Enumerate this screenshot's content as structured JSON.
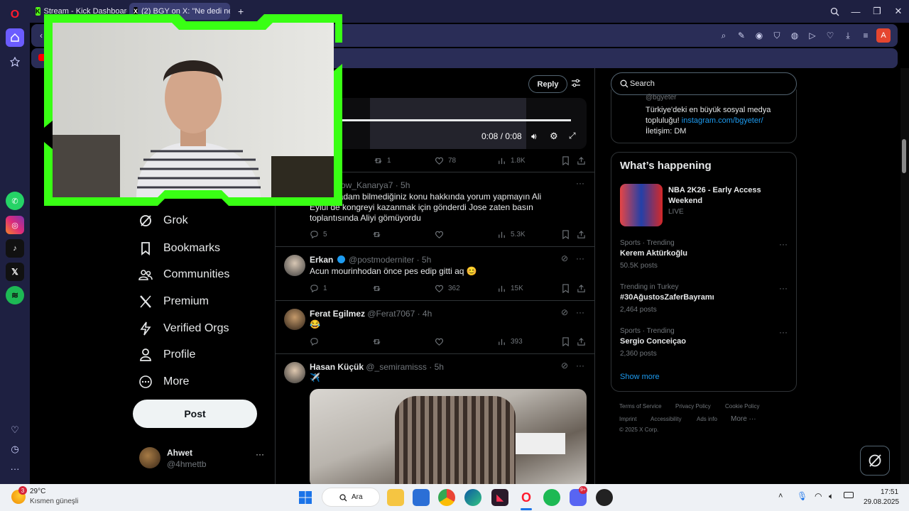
{
  "browser": {
    "tabs": [
      {
        "title": "Stream - Kick Dashboard",
        "icon": "kick-icon"
      },
      {
        "title": "(2) BGY on X: \"Ne dedi ne",
        "icon": "x-icon"
      }
    ],
    "add_tab": "+"
  },
  "x": {
    "nav": {
      "grok": "Grok",
      "bookmarks": "Bookmarks",
      "communities": "Communities",
      "premium": "Premium",
      "verified_orgs": "Verified Orgs",
      "profile": "Profile",
      "more": "More",
      "post": "Post"
    },
    "account": {
      "name": "Ahwet",
      "handle": "@4hmettb"
    },
    "thread_header": {
      "reply": "Reply"
    },
    "video": {
      "time": "0:08 / 0:08"
    },
    "top_tweet_stats": {
      "retweets": "1",
      "likes": "78",
      "views": "1.8K"
    },
    "tweets": [
      {
        "handle": "ow_Kanarya7 · 5h",
        "text": "değil ki adam bilmediğiniz konu hakkında yorum yapmayın Ali Eylül de kongreyi kazanmak için gönderdi Jose zaten basın toplantısında Aliyi gömüyordu",
        "replies": "5",
        "retweets": "",
        "likes": "",
        "views": "5.3K"
      },
      {
        "name": "Erkan",
        "handle": "@postmoderniter · 5h",
        "text": "Acun mourinhodan önce pes edip gitti aq 😊",
        "replies": "1",
        "retweets": "",
        "likes": "362",
        "views": "15K"
      },
      {
        "name": "Ferat Egilmez",
        "handle": "@Ferat7067 · 4h",
        "text": "😂",
        "replies": "",
        "retweets": "",
        "likes": "",
        "views": "393"
      },
      {
        "name": "Hasan Küçük",
        "handle": "@_semiramisss · 5h",
        "text": "✈️"
      }
    ],
    "search_placeholder": "Search",
    "profile_card": {
      "handle": "@bgyeter",
      "bio_line1": "Türkiye'deki en büyük sosyal medya",
      "bio_line2": "topluluğu! ",
      "link": "instagram.com/bgyeter/",
      "contact": "İletişim: DM"
    },
    "whats_happening": {
      "title": "What’s happening",
      "featured": {
        "title": "NBA 2K26 - Early Access Weekend",
        "status": "LIVE"
      },
      "trends": [
        {
          "meta": "Sports · Trending",
          "title": "Kerem Aktürkoğlu",
          "count": "50.5K posts"
        },
        {
          "meta": "Trending in Turkey",
          "title": "#30AğustosZaferBayramı",
          "count": "2,464 posts"
        },
        {
          "meta": "Sports · Trending",
          "title": "Sergio Conceiçao",
          "count": "2,360 posts"
        }
      ],
      "show_more": "Show more"
    },
    "footer": {
      "terms": "Terms of Service",
      "privacy": "Privacy Policy",
      "cookie": "Cookie Policy",
      "imprint": "Imprint",
      "accessibility": "Accessibility",
      "ads": "Ads info",
      "more": "More ···",
      "copyright": "© 2025 X Corp."
    }
  },
  "taskbar": {
    "weather_temp": "29°C",
    "weather_desc": "Kısmen güneşli",
    "weather_badge": "3",
    "search": "Ara",
    "discord_badge": "9+",
    "time": "17:51",
    "date": "29.08.2025"
  },
  "colors": {
    "accent_blue": "#1d9bf0",
    "webcam_frame": "#39ff14",
    "opera_red": "#ff1b2d",
    "browser_bg": "#1e2041"
  }
}
